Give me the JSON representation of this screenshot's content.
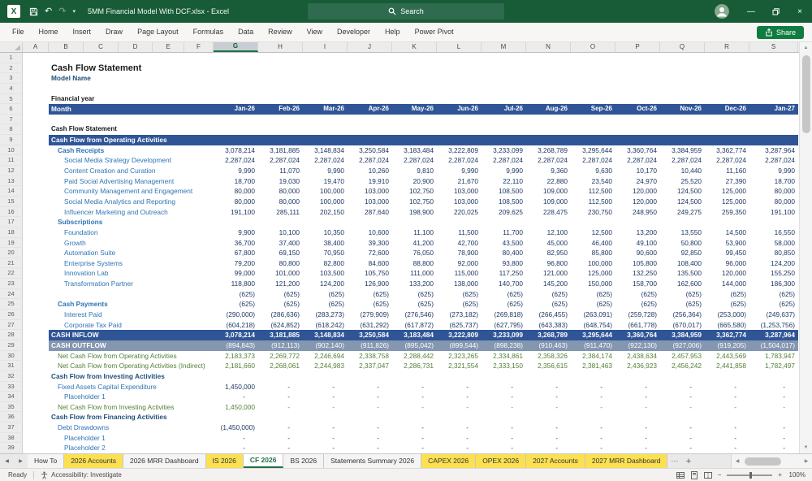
{
  "colors": {
    "titlebar_green": "#185C37",
    "search_box_green": "#2F6B4F",
    "share_green": "#107C41",
    "banner_blue": "#2F5597",
    "outflow_blue": "#8496B0",
    "label_blue": "#2E74B5",
    "value_navy": "#1F3864",
    "section_navy": "#1F4E79",
    "net_green": "#538135",
    "tab_yellow": "#FBE052",
    "active_tab_green": "#1E7145"
  },
  "glyphs": {
    "excel_logo": "X",
    "undo": "↶",
    "redo": "↷",
    "qat_menu": "▾",
    "minimize": "—",
    "close": "×",
    "sheet_prev": "◀",
    "sheet_next": "▶",
    "sheet_more": "⋯",
    "add_sheet": "+",
    "vscroll_up": "▲",
    "vscroll_down": "▼",
    "hscroll_left": "◀",
    "hscroll_right": "▶",
    "zoom_out": "−",
    "zoom_in": "+"
  },
  "titlebar": {
    "title": "5MM Financial Model With DCF.xlsx - Excel",
    "search_label": "Search"
  },
  "ribbon": {
    "tabs": [
      "File",
      "Home",
      "Insert",
      "Draw",
      "Page Layout",
      "Formulas",
      "Data",
      "Review",
      "View",
      "Developer",
      "Help",
      "Power Pivot"
    ],
    "share_label": "Share"
  },
  "grid": {
    "column_letters": [
      "A",
      "B",
      "C",
      "D",
      "E",
      "F",
      "G",
      "H",
      "I",
      "J",
      "K",
      "L",
      "M",
      "N",
      "O",
      "P",
      "Q",
      "R",
      "S"
    ],
    "selected_column": "G",
    "row_count": 39
  },
  "sheet": {
    "months": [
      "Jan-26",
      "Feb-26",
      "Mar-26",
      "Apr-26",
      "May-26",
      "Jun-26",
      "Jul-26",
      "Aug-26",
      "Sep-26",
      "Oct-26",
      "Nov-26",
      "Dec-26",
      "Jan-27"
    ],
    "rows": [
      {
        "n": 2,
        "label": "Cash Flow Statement",
        "style": "title"
      },
      {
        "n": 3,
        "label": "Model Name",
        "style": "subtitle"
      },
      {
        "n": 5,
        "label": "Financial year",
        "style": "small-bold"
      },
      {
        "n": 6,
        "label": "Month",
        "style": "month-header",
        "values": [
          "Jan-26",
          "Feb-26",
          "Mar-26",
          "Apr-26",
          "May-26",
          "Jun-26",
          "Jul-26",
          "Aug-26",
          "Sep-26",
          "Oct-26",
          "Nov-26",
          "Dec-26",
          "Jan-27"
        ]
      },
      {
        "n": 8,
        "label": "Cash Flow Statement",
        "style": "small-bold"
      },
      {
        "n": 9,
        "label": "Cash Flow from Operating Activities",
        "style": "banner"
      },
      {
        "n": 10,
        "label": "Cash Receipts",
        "style": "item-bold",
        "indent": 1,
        "values": [
          "3,078,214",
          "3,181,885",
          "3,148,834",
          "3,250,584",
          "3,183,484",
          "3,222,809",
          "3,233,099",
          "3,268,789",
          "3,295,644",
          "3,360,764",
          "3,384,959",
          "3,362,774",
          "3,287,964"
        ]
      },
      {
        "n": 11,
        "label": "Social Media Strategy Development",
        "style": "item",
        "indent": 2,
        "values": [
          "2,287,024",
          "2,287,024",
          "2,287,024",
          "2,287,024",
          "2,287,024",
          "2,287,024",
          "2,287,024",
          "2,287,024",
          "2,287,024",
          "2,287,024",
          "2,287,024",
          "2,287,024",
          "2,287,024"
        ]
      },
      {
        "n": 12,
        "label": "Content Creation and Curation",
        "style": "item",
        "indent": 2,
        "values": [
          "9,990",
          "11,070",
          "9,990",
          "10,260",
          "9,810",
          "9,990",
          "9,990",
          "9,360",
          "9,630",
          "10,170",
          "10,440",
          "11,160",
          "9,990"
        ]
      },
      {
        "n": 13,
        "label": "Paid Social Advertising Management",
        "style": "item",
        "indent": 2,
        "values": [
          "18,700",
          "19,030",
          "19,470",
          "19,910",
          "20,900",
          "21,670",
          "22,110",
          "22,880",
          "23,540",
          "24,970",
          "25,520",
          "27,390",
          "18,700"
        ]
      },
      {
        "n": 14,
        "label": "Community Management and Engagement",
        "style": "item",
        "indent": 2,
        "values": [
          "80,000",
          "80,000",
          "100,000",
          "103,000",
          "102,750",
          "103,000",
          "108,500",
          "109,000",
          "112,500",
          "120,000",
          "124,500",
          "125,000",
          "80,000"
        ]
      },
      {
        "n": 15,
        "label": "Social Media Analytics and Reporting",
        "style": "item",
        "indent": 2,
        "values": [
          "80,000",
          "80,000",
          "100,000",
          "103,000",
          "102,750",
          "103,000",
          "108,500",
          "109,000",
          "112,500",
          "120,000",
          "124,500",
          "125,000",
          "80,000"
        ]
      },
      {
        "n": 16,
        "label": "Influencer Marketing and Outreach",
        "style": "item",
        "indent": 2,
        "values": [
          "191,100",
          "285,111",
          "202,150",
          "287,640",
          "198,900",
          "220,025",
          "209,625",
          "228,475",
          "230,750",
          "248,950",
          "249,275",
          "259,350",
          "191,100"
        ]
      },
      {
        "n": 17,
        "label": "Subscriptions",
        "style": "item-bold",
        "indent": 1
      },
      {
        "n": 18,
        "label": "Foundation",
        "style": "item",
        "indent": 2,
        "values": [
          "9,900",
          "10,100",
          "10,350",
          "10,600",
          "11,100",
          "11,500",
          "11,700",
          "12,100",
          "12,500",
          "13,200",
          "13,550",
          "14,500",
          "16,550"
        ]
      },
      {
        "n": 19,
        "label": "Growth",
        "style": "item",
        "indent": 2,
        "values": [
          "36,700",
          "37,400",
          "38,400",
          "39,300",
          "41,200",
          "42,700",
          "43,500",
          "45,000",
          "46,400",
          "49,100",
          "50,800",
          "53,900",
          "58,000"
        ]
      },
      {
        "n": 20,
        "label": "Automation Suite",
        "style": "item",
        "indent": 2,
        "values": [
          "67,800",
          "69,150",
          "70,950",
          "72,600",
          "76,050",
          "78,900",
          "80,400",
          "82,950",
          "85,800",
          "90,600",
          "92,850",
          "99,450",
          "80,850"
        ]
      },
      {
        "n": 21,
        "label": "Enterprise Systems",
        "style": "item",
        "indent": 2,
        "values": [
          "79,200",
          "80,800",
          "82,800",
          "84,600",
          "88,800",
          "92,000",
          "93,800",
          "96,800",
          "100,000",
          "105,800",
          "108,400",
          "96,000",
          "124,200"
        ]
      },
      {
        "n": 22,
        "label": "Innovation Lab",
        "style": "item",
        "indent": 2,
        "values": [
          "99,000",
          "101,000",
          "103,500",
          "105,750",
          "111,000",
          "115,000",
          "117,250",
          "121,000",
          "125,000",
          "132,250",
          "135,500",
          "120,000",
          "155,250"
        ]
      },
      {
        "n": 23,
        "label": "Transformation Partner",
        "style": "item",
        "indent": 2,
        "values": [
          "118,800",
          "121,200",
          "124,200",
          "126,900",
          "133,200",
          "138,000",
          "140,700",
          "145,200",
          "150,000",
          "158,700",
          "162,600",
          "144,000",
          "186,300"
        ]
      },
      {
        "n": 24,
        "label": "",
        "style": "item",
        "values": [
          "(625)",
          "(625)",
          "(625)",
          "(625)",
          "(625)",
          "(625)",
          "(625)",
          "(625)",
          "(625)",
          "(625)",
          "(625)",
          "(625)",
          "(625)"
        ]
      },
      {
        "n": 25,
        "label": "Cash Payments",
        "style": "item-bold",
        "indent": 1,
        "values": [
          "(625)",
          "(625)",
          "(625)",
          "(625)",
          "(625)",
          "(625)",
          "(625)",
          "(625)",
          "(625)",
          "(625)",
          "(625)",
          "(625)",
          "(625)"
        ]
      },
      {
        "n": 26,
        "label": "Interest Paid",
        "style": "item",
        "indent": 2,
        "values": [
          "(290,000)",
          "(286,636)",
          "(283,273)",
          "(279,909)",
          "(276,546)",
          "(273,182)",
          "(269,818)",
          "(266,455)",
          "(263,091)",
          "(259,728)",
          "(256,364)",
          "(253,000)",
          "(249,637)"
        ]
      },
      {
        "n": 27,
        "label": "Corporate Tax Paid",
        "style": "item",
        "indent": 2,
        "values": [
          "(604,218)",
          "(624,852)",
          "(618,242)",
          "(631,292)",
          "(617,872)",
          "(625,737)",
          "(627,795)",
          "(643,383)",
          "(648,754)",
          "(661,778)",
          "(670,017)",
          "(665,580)",
          "(1,253,756)"
        ]
      },
      {
        "n": 28,
        "label": "CASH INFLOW",
        "style": "total-dark",
        "values": [
          "3,078,214",
          "3,181,885",
          "3,148,834",
          "3,250,584",
          "3,183,484",
          "3,222,809",
          "3,233,099",
          "3,268,789",
          "3,295,644",
          "3,360,764",
          "3,384,959",
          "3,362,774",
          "3,287,964"
        ]
      },
      {
        "n": 29,
        "label": "CASH OUTFLOW",
        "style": "total-gray",
        "values": [
          "(894,843)",
          "(912,113)",
          "(902,140)",
          "(911,826)",
          "(895,042)",
          "(899,544)",
          "(898,238)",
          "(910,463)",
          "(911,470)",
          "(922,130)",
          "(927,006)",
          "(919,205)",
          "(1,504,017)"
        ]
      },
      {
        "n": 30,
        "label": "Net Cash Flow from Operating Activities",
        "style": "net",
        "indent": 1,
        "values": [
          "2,183,373",
          "2,269,772",
          "2,246,694",
          "2,338,758",
          "2,288,442",
          "2,323,265",
          "2,334,861",
          "2,358,326",
          "2,384,174",
          "2,438,634",
          "2,457,953",
          "2,443,569",
          "1,783,947"
        ]
      },
      {
        "n": 31,
        "label": "Net Cash Flow from Operating Activities (Indirect)",
        "style": "net",
        "indent": 1,
        "values": [
          "2,181,660",
          "2,268,061",
          "2,244,983",
          "2,337,047",
          "2,286,731",
          "2,321,554",
          "2,333,150",
          "2,356,615",
          "2,381,463",
          "2,436,923",
          "2,456,242",
          "2,441,858",
          "1,782,497"
        ]
      },
      {
        "n": 32,
        "label": "Cash Flow from Investing Activities",
        "style": "section"
      },
      {
        "n": 33,
        "label": "Fixed Assets Capital Expenditure",
        "style": "item",
        "indent": 1,
        "values": [
          "1,450,000",
          "-",
          "-",
          "-",
          "-",
          "-",
          "-",
          "-",
          "-",
          "-",
          "-",
          "-",
          "-"
        ]
      },
      {
        "n": 34,
        "label": "Placeholder 1",
        "style": "item",
        "indent": 2,
        "values": [
          "-",
          "-",
          "-",
          "-",
          "-",
          "-",
          "-",
          "-",
          "-",
          "-",
          "-",
          "-",
          "-"
        ]
      },
      {
        "n": 35,
        "label": "Net Cash Flow from Investing Activities",
        "style": "net",
        "indent": 1,
        "values": [
          "1,450,000",
          "-",
          "-",
          "-",
          "-",
          "-",
          "-",
          "-",
          "-",
          "-",
          "-",
          "-",
          "-"
        ]
      },
      {
        "n": 36,
        "label": "Cash Flow from Financing Activities",
        "style": "section"
      },
      {
        "n": 37,
        "label": "Debt Drawdowns",
        "style": "item",
        "indent": 1,
        "values": [
          "(1,450,000)",
          "-",
          "-",
          "-",
          "-",
          "-",
          "-",
          "-",
          "-",
          "-",
          "-",
          "-",
          "-"
        ]
      },
      {
        "n": 38,
        "label": "Placeholder 1",
        "style": "item",
        "indent": 2,
        "values": [
          "-",
          "-",
          "-",
          "-",
          "-",
          "-",
          "-",
          "-",
          "-",
          "-",
          "-",
          "-",
          "-"
        ]
      },
      {
        "n": 39,
        "label": "Placeholder 2",
        "style": "item",
        "indent": 2,
        "values": [
          "-",
          "-",
          "-",
          "-",
          "-",
          "-",
          "-",
          "-",
          "-",
          "-",
          "-",
          "-",
          "-"
        ]
      }
    ]
  },
  "sheet_tabs": {
    "tabs": [
      {
        "label": "How To",
        "style": "plain"
      },
      {
        "label": "2026 Accounts",
        "style": "yellow"
      },
      {
        "label": "2026 MRR Dashboard",
        "style": "plain"
      },
      {
        "label": "IS 2026",
        "style": "yellow"
      },
      {
        "label": "CF 2026",
        "style": "active"
      },
      {
        "label": "BS 2026",
        "style": "plain"
      },
      {
        "label": "Statements Summary 2026",
        "style": "plain"
      },
      {
        "label": "CAPEX 2026",
        "style": "yellow"
      },
      {
        "label": "OPEX 2026",
        "style": "yellow"
      },
      {
        "label": "2027 Accounts",
        "style": "yellow"
      },
      {
        "label": "2027 MRR Dashboard",
        "style": "yellow"
      }
    ]
  },
  "statusbar": {
    "ready": "Ready",
    "accessibility": "Accessibility: Investigate",
    "zoom_level": "100%"
  }
}
